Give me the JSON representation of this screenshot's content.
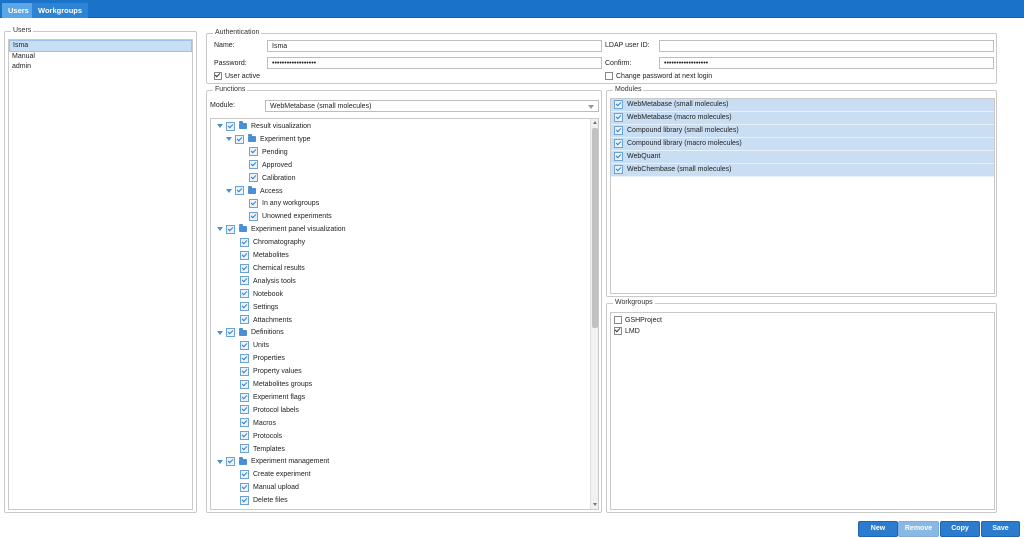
{
  "tabs": [
    {
      "label": "Users",
      "active": true
    },
    {
      "label": "Workgroups",
      "active": false
    }
  ],
  "users_panel": {
    "legend": "Users",
    "items": [
      "Isma",
      "Manual",
      "admin"
    ],
    "selected": "Isma"
  },
  "auth": {
    "legend": "Authentication",
    "name_label": "Name:",
    "name_value": "Isma",
    "password_label": "Password:",
    "password_value": "••••••••••••••••••",
    "ldap_label": "LDAP user ID:",
    "ldap_value": "",
    "confirm_label": "Confirm:",
    "confirm_value": "••••••••••••••••••",
    "user_active_label": "User active",
    "user_active_checked": true,
    "change_password_label": "Change password at next login",
    "change_password_checked": false
  },
  "functions": {
    "legend": "Functions",
    "module_label": "Module:",
    "module_value": "WebMetabase (small molecules)",
    "tree": [
      {
        "label": "Result visualization",
        "level": 0,
        "folder": true
      },
      {
        "label": "Experiment type",
        "level": 1,
        "folder": true
      },
      {
        "label": "Pending",
        "level": 2
      },
      {
        "label": "Approved",
        "level": 2
      },
      {
        "label": "Calibration",
        "level": 2
      },
      {
        "label": "Access",
        "level": 1,
        "folder": true
      },
      {
        "label": "In any workgroups",
        "level": 2
      },
      {
        "label": "Unowned experiments",
        "level": 2
      },
      {
        "label": "Experiment panel visualization",
        "level": 0,
        "folder": true
      },
      {
        "label": "Chromatography",
        "level": 1
      },
      {
        "label": "Metabolites",
        "level": 1
      },
      {
        "label": "Chemical results",
        "level": 1
      },
      {
        "label": "Analysis tools",
        "level": 1
      },
      {
        "label": "Notebook",
        "level": 1
      },
      {
        "label": "Settings",
        "level": 1
      },
      {
        "label": "Attachments",
        "level": 1
      },
      {
        "label": "Definitions",
        "level": 0,
        "folder": true
      },
      {
        "label": "Units",
        "level": 1
      },
      {
        "label": "Properties",
        "level": 1
      },
      {
        "label": "Property values",
        "level": 1
      },
      {
        "label": "Metabolites groups",
        "level": 1
      },
      {
        "label": "Experiment flags",
        "level": 1
      },
      {
        "label": "Protocol labels",
        "level": 1
      },
      {
        "label": "Macros",
        "level": 1
      },
      {
        "label": "Protocols",
        "level": 1
      },
      {
        "label": "Templates",
        "level": 1
      },
      {
        "label": "Experiment management",
        "level": 0,
        "folder": true
      },
      {
        "label": "Create experiment",
        "level": 1
      },
      {
        "label": "Manual upload",
        "level": 1
      },
      {
        "label": "Delete files",
        "level": 1
      }
    ]
  },
  "modules": {
    "legend": "Modules",
    "items": [
      "WebMetabase (small molecules)",
      "WebMetabase (macro molecules)",
      "Compound library (small molecules)",
      "Compound library (macro molecules)",
      "WebQuant",
      "WebChembase (small molecules)"
    ]
  },
  "workgroups": {
    "legend": "Workgroups",
    "items": [
      {
        "label": "GSHProject",
        "checked": false
      },
      {
        "label": "LMD",
        "checked": true
      }
    ]
  },
  "buttons": {
    "new": "New",
    "remove": "Remove",
    "copy": "Copy",
    "save": "Save"
  },
  "colors": {
    "accent": "#1a73c9",
    "selection": "#c8def4",
    "button": "#2b7ccf"
  }
}
